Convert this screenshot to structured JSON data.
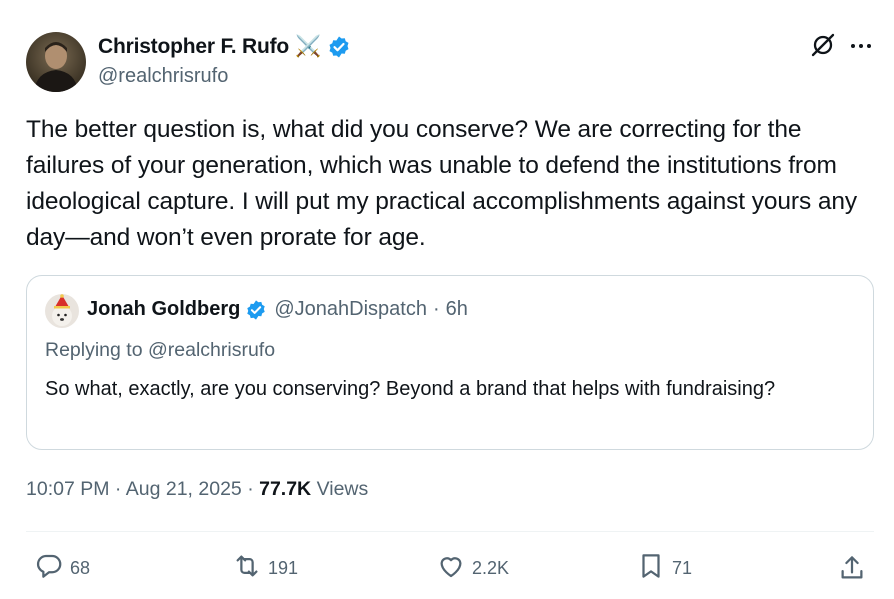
{
  "author": {
    "name": "Christopher F. Rufo",
    "emoji": "⚔️",
    "handle": "@realchrisrufo",
    "verified_color": "#1d9bf0"
  },
  "tweet": {
    "text": "The better question is, what did you conserve? We are correcting for the failures of your generation, which was unable to defend the institutions from ideological capture. I will put my practical accomplishments against yours any day—and won’t even prorate for age.",
    "time": "10:07 PM",
    "date": "Aug 21, 2025",
    "views_count": "77.7K",
    "views_label": "Views"
  },
  "quote": {
    "name": "Jonah Goldberg",
    "handle": "@JonahDispatch",
    "age": "6h",
    "replying_prefix": "Replying to",
    "replying_to": "@realchrisrufo",
    "text": "So what, exactly, are you conserving? Beyond a brand that helps with fundraising?"
  },
  "actions": {
    "replies": "68",
    "reposts": "191",
    "likes": "2.2K",
    "bookmarks": "71"
  },
  "icons": {
    "reply": "reply-icon",
    "repost": "repost-icon",
    "like": "heart-icon",
    "bookmark": "bookmark-icon",
    "share": "share-icon",
    "grok": "grok-icon",
    "more": "more-icon"
  },
  "colors": {
    "text": "#0f1419",
    "secondary": "#536471",
    "border": "#cfd9de",
    "verified": "#1d9bf0"
  }
}
